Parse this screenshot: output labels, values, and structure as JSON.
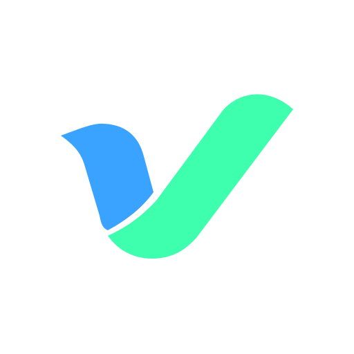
{
  "logo": {
    "icon": "checkmark-bird-logo",
    "colors": {
      "background": "#ffffff",
      "blue": "#3aa3ff",
      "green": "#3dffae"
    }
  }
}
